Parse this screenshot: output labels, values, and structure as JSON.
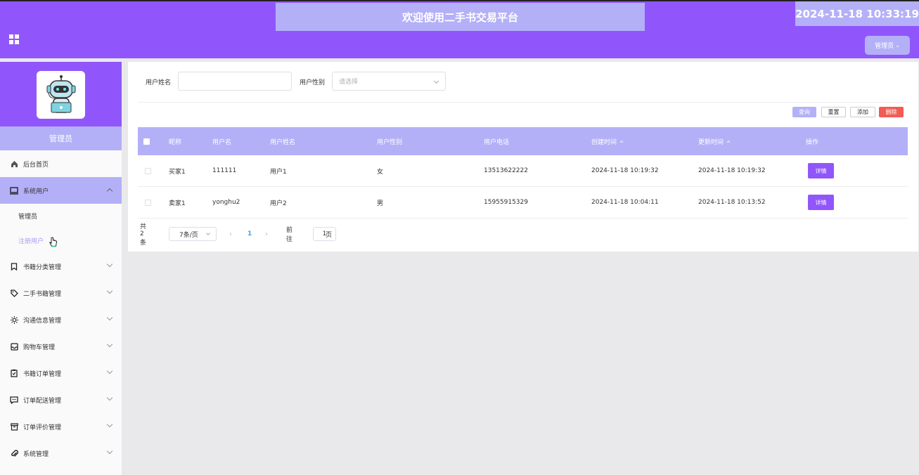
{
  "header": {
    "title": "欢迎使用二手书交易平台",
    "datetime": "2024-11-18 10:33:19",
    "admin_label": "管理员"
  },
  "sidebar": {
    "role": "管理员",
    "items": [
      {
        "label": "后台首页",
        "icon": "home-icon"
      },
      {
        "label": "系统用户",
        "icon": "monitor-icon"
      },
      {
        "label": "书籍分类管理",
        "icon": "bookmark-icon"
      },
      {
        "label": "二手书籍管理",
        "icon": "tag-icon"
      },
      {
        "label": "沟通信息管理",
        "icon": "sun-icon"
      },
      {
        "label": "购物车管理",
        "icon": "inbox-icon"
      },
      {
        "label": "书籍订单管理",
        "icon": "clipboard-icon"
      },
      {
        "label": "订单配送管理",
        "icon": "message-icon"
      },
      {
        "label": "订单评价管理",
        "icon": "archive-icon"
      },
      {
        "label": "系统管理",
        "icon": "paperclip-icon"
      }
    ],
    "sub_items": [
      {
        "label": "管理员"
      },
      {
        "label": "注册用户"
      }
    ]
  },
  "filters": {
    "name_label": "用户姓名",
    "name_value": "",
    "gender_label": "用户性别",
    "gender_placeholder": "请选择"
  },
  "actions": {
    "query": "查询",
    "reset": "重置",
    "add": "添加",
    "delete": "删除"
  },
  "table": {
    "columns": [
      "昵称",
      "用户名",
      "用户姓名",
      "用户性别",
      "用户电话",
      "创建时间",
      "更新时间",
      "操作"
    ],
    "rows": [
      {
        "nickname": "买家1",
        "username": "111111",
        "realname": "用户1",
        "gender": "女",
        "phone": "13513622222",
        "created": "2024-11-18 10:19:32",
        "updated": "2024-11-18 10:19:32",
        "action": "详情"
      },
      {
        "nickname": "卖家1",
        "username": "yonghu2",
        "realname": "用户2",
        "gender": "男",
        "phone": "15955915329",
        "created": "2024-11-18 10:04:11",
        "updated": "2024-11-18 10:13:52",
        "action": "详情"
      }
    ]
  },
  "pagination": {
    "total": "共 2 条",
    "page_size": "7条/页",
    "prev": "‹",
    "current": "1",
    "next": "›",
    "goto_label": "前往",
    "goto_value": "1",
    "page_suffix": "页"
  }
}
